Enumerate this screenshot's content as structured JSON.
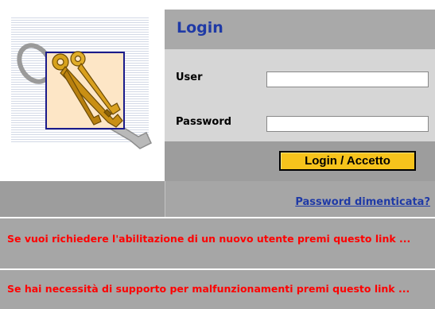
{
  "login": {
    "title": "Login",
    "user_label": "User",
    "user_value": "",
    "password_label": "Password",
    "password_value": "",
    "submit_label": "Login / Accetto"
  },
  "links": {
    "forgot_password": "Password dimenticata?",
    "new_user_request": "Se vuoi richiedere l'abilitazione di un nuovo utente premi questo link ...",
    "support_request": "Se hai necessità di supporto per malfunzionamenti premi questo link ..."
  },
  "colors": {
    "title_blue": "#1f3aa6",
    "button_yellow": "#f6c31c",
    "alert_red": "#ff0000",
    "panel_gray": "#a9a9a9"
  },
  "icons": {
    "logo": "keys-icon"
  }
}
